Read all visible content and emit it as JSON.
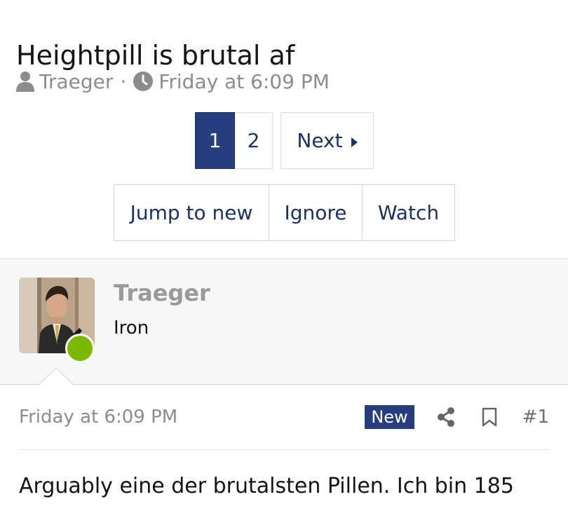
{
  "thread": {
    "title": "Heightpill is brutal af",
    "author": "Traeger",
    "separator": "·",
    "posted": "Friday at 6:09 PM"
  },
  "pagination": {
    "pages": [
      "1",
      "2"
    ],
    "current": "1",
    "next_label": "Next"
  },
  "actions": {
    "jump_label": "Jump to new",
    "ignore_label": "Ignore",
    "watch_label": "Watch"
  },
  "post": {
    "username": "Traeger",
    "user_title": "Iron",
    "online": true,
    "date": "Friday at 6:09 PM",
    "badge": "New",
    "number": "#1",
    "body": "Arguably eine der brutalsten Pillen. Ich bin 185"
  },
  "colors": {
    "accent": "#263e7e",
    "link": "#1c3163",
    "online": "#7cb800",
    "muted": "#8c8c8c"
  },
  "icons": [
    "user-icon",
    "clock-icon",
    "caret-right-icon",
    "share-icon",
    "bookmark-icon"
  ]
}
